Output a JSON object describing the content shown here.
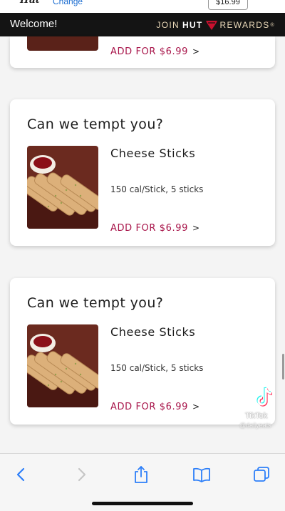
{
  "top_strip": {
    "logo_text": "Hut",
    "change_link": "Change",
    "cart_price": "$16.99"
  },
  "header": {
    "welcome": "Welcome!",
    "rewards_join": "JOIN",
    "rewards_hut": "HUT",
    "rewards_label": "REWARDS",
    "rewards_tm": "®",
    "accent_color": "#c8102e"
  },
  "partial_card": {
    "add_link": "ADD FOR $6.99"
  },
  "upsell_cards": [
    {
      "title": "Can we tempt you?",
      "product_name": "Cheese Sticks",
      "description": "150 cal/Stick, 5 sticks",
      "add_link": "ADD FOR $6.99"
    },
    {
      "title": "Can we tempt you?",
      "product_name": "Cheese Sticks",
      "description": "150 cal/Stick, 5 sticks",
      "add_link": "ADD FOR $6.99"
    }
  ],
  "tiktok": {
    "label": "TikTok",
    "username": "@dailyeats"
  },
  "browser_toolbar": {
    "icons": [
      "back-icon",
      "forward-icon",
      "share-icon",
      "bookmarks-icon",
      "tabs-icon"
    ],
    "tint_color": "#2d7ff9"
  }
}
